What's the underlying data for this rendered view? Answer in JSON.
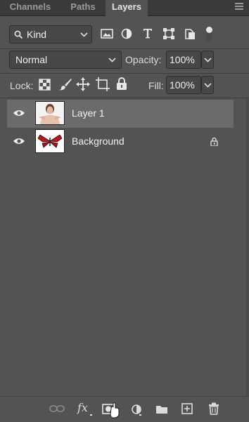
{
  "tabs": [
    {
      "label": "Channels"
    },
    {
      "label": "Paths"
    },
    {
      "label": "Layers"
    }
  ],
  "filter": {
    "label": "Kind"
  },
  "blend": {
    "mode": "Normal",
    "opacity_label": "Opacity:",
    "opacity_value": "100%"
  },
  "lock": {
    "label": "Lock:",
    "fill_label": "Fill:",
    "fill_value": "100%"
  },
  "layers": [
    {
      "name": "Layer 1",
      "selected": true,
      "visible": true
    },
    {
      "name": "Background",
      "selected": false,
      "visible": true,
      "locked": true
    }
  ],
  "bottom": {
    "fx_label": "fx"
  },
  "colors": {
    "panel": "#535353",
    "tabbar": "#3a3a3a",
    "selected_row": "#6b6b6b",
    "butterfly": "#c0141a"
  }
}
